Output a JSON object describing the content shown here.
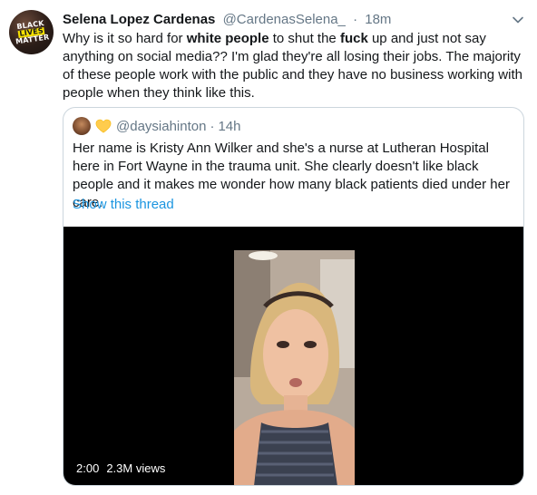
{
  "tweet": {
    "avatar_text": [
      "BLACK",
      "LIVES",
      "MATTER"
    ],
    "name": "Selena Lopez Cardenas",
    "handle": "@CardenasSelena_",
    "separator": "·",
    "time": "18m",
    "text_parts": [
      "Why is it so hard for ",
      "white people",
      " to shut the ",
      "fuck",
      " up and just not say anything on social media?? I'm glad they're all losing their jobs. The majority of these people work with the public and they have no business working with people when they think like this."
    ]
  },
  "quoted": {
    "handle": "@daysiahinton",
    "separator": "·",
    "time": "14h",
    "heart_emoji": "yellow-heart",
    "text": "Her name is Kristy Ann Wilker and she's a nurse at Lutheran Hospital here in Fort Wayne in the trauma unit. She clearly doesn't like black people and it makes me wonder how many black patients died under her care.",
    "show_thread": "Show this thread",
    "video": {
      "duration": "2:00",
      "views": "2.3M views"
    }
  },
  "colors": {
    "text": "#14171a",
    "secondary": "#657786",
    "link": "#1b95e0",
    "border": "#ccd6dd",
    "video_bg": "#000000"
  },
  "icons": [
    "chevron-down-icon"
  ]
}
